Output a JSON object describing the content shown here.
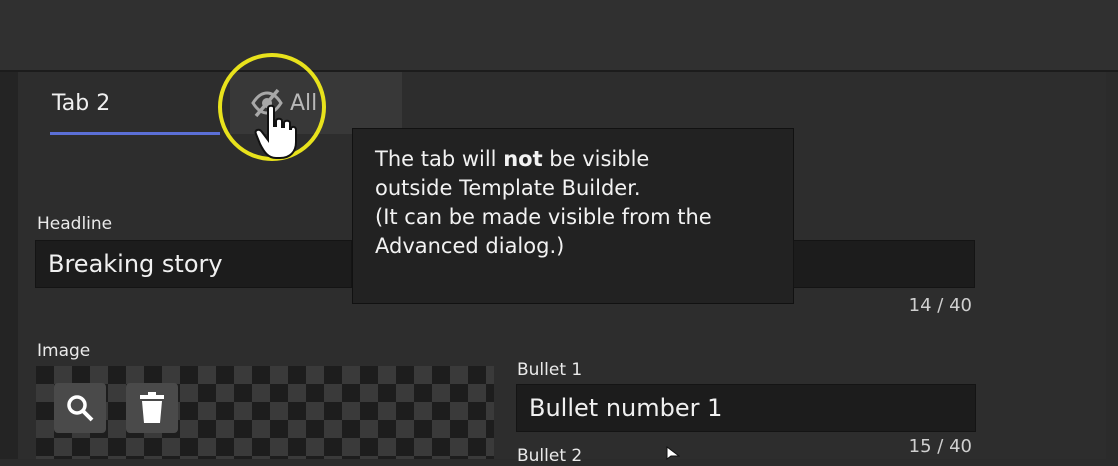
{
  "tabs": {
    "tab2_label": "Tab 2",
    "hidden_tab_label": "All"
  },
  "tooltip": {
    "line1_pre": "The tab will ",
    "line1_bold": "not",
    "line1_post": " be visible",
    "line2": "outside Template Builder.",
    "line3": "(It can be made visible from the",
    "line4": "Advanced dialog.)"
  },
  "headline": {
    "label": "Headline",
    "value": "Breaking story",
    "counter": "14 / 40"
  },
  "image": {
    "label": "Image"
  },
  "bullet1": {
    "label": "Bullet 1",
    "value": "Bullet number 1",
    "counter": "15 / 40"
  },
  "bullet2": {
    "label": "Bullet 2"
  },
  "colors": {
    "tab_underline": "#5b6fd6",
    "cursor_highlight": "#e8e21c"
  }
}
